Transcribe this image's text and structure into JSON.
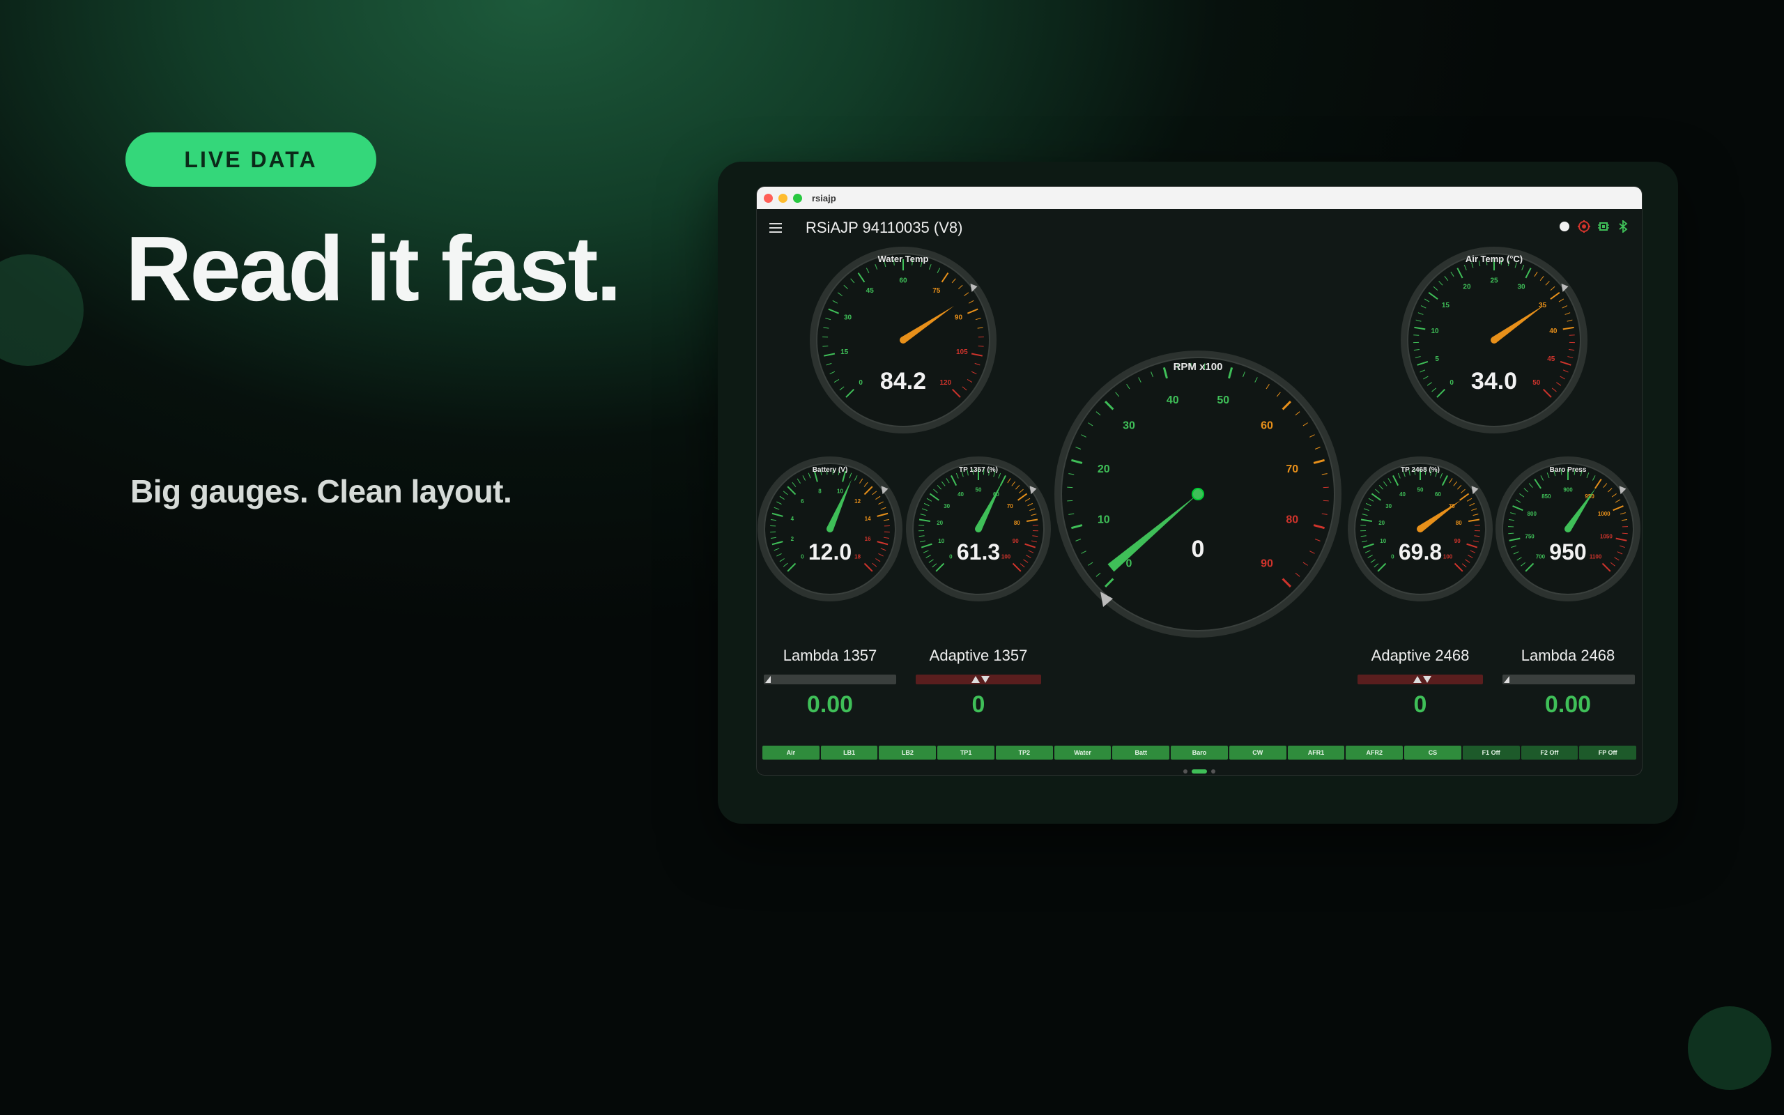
{
  "hero": {
    "badge": "LIVE DATA",
    "headline": "Read it fast.",
    "subline": "Big gauges. Clean layout."
  },
  "window": {
    "title": "rsiajp",
    "app_title": "RSiAJP 94110035 (V8)",
    "status_icons": [
      "record-dot-icon",
      "target-icon",
      "chip-icon",
      "bluetooth-icon"
    ]
  },
  "gauges": [
    {
      "id": "water-temp",
      "title": "Water Temp",
      "value": "84.2",
      "ticks": [
        "0",
        "15",
        "30",
        "45",
        "60",
        "75",
        "90",
        "105",
        "120"
      ],
      "needle_color": "#e8901a"
    },
    {
      "id": "air-temp",
      "title": "Air Temp (°C)",
      "value": "34.0",
      "ticks": [
        "0",
        "5",
        "10",
        "15",
        "20",
        "25",
        "30",
        "35",
        "40",
        "45",
        "50"
      ],
      "needle_color": "#e8901a"
    },
    {
      "id": "rpm",
      "title": "RPM x100",
      "value": "0",
      "ticks": [
        "0",
        "10",
        "20",
        "30",
        "40",
        "50",
        "60",
        "70",
        "80",
        "90"
      ],
      "needle_color": "#3fbf58"
    },
    {
      "id": "battery",
      "title": "Battery (V)",
      "value": "12.0",
      "ticks": [
        "0",
        "2",
        "4",
        "6",
        "8",
        "10",
        "12",
        "14",
        "16",
        "18"
      ],
      "needle_color": "#3fbf58"
    },
    {
      "id": "tp1357",
      "title": "TP 1357 (%)",
      "value": "61.3",
      "ticks": [
        "0",
        "10",
        "20",
        "30",
        "40",
        "50",
        "60",
        "70",
        "80",
        "90",
        "100"
      ],
      "needle_color": "#3fbf58"
    },
    {
      "id": "tp2468",
      "title": "TP 2468 (%)",
      "value": "69.8",
      "ticks": [
        "0",
        "10",
        "20",
        "30",
        "40",
        "50",
        "60",
        "70",
        "80",
        "90",
        "100"
      ],
      "needle_color": "#e8901a"
    },
    {
      "id": "baro",
      "title": "Baro Press",
      "value": "950",
      "ticks": [
        "700",
        "750",
        "800",
        "850",
        "900",
        "950",
        "1000",
        "1050",
        "1100"
      ],
      "needle_color": "#3fbf58"
    }
  ],
  "bottom": {
    "lambda1357": {
      "label": "Lambda 1357",
      "value": "0.00"
    },
    "adaptive1357": {
      "label": "Adaptive 1357",
      "value": "0"
    },
    "adaptive2468": {
      "label": "Adaptive 2468",
      "value": "0"
    },
    "lambda2468": {
      "label": "Lambda 2468",
      "value": "0.00"
    }
  },
  "chips": [
    "Air",
    "LB1",
    "LB2",
    "TP1",
    "TP2",
    "Water",
    "Batt",
    "Baro",
    "CW",
    "AFR1",
    "AFR2",
    "CS",
    "F1 Off",
    "F2 Off",
    "FP Off"
  ],
  "pager": {
    "count": 3,
    "active": 1
  },
  "colors": {
    "accent": "#34d77a",
    "green": "#3fbf58",
    "orange": "#e8901a",
    "red": "#d0342c"
  }
}
